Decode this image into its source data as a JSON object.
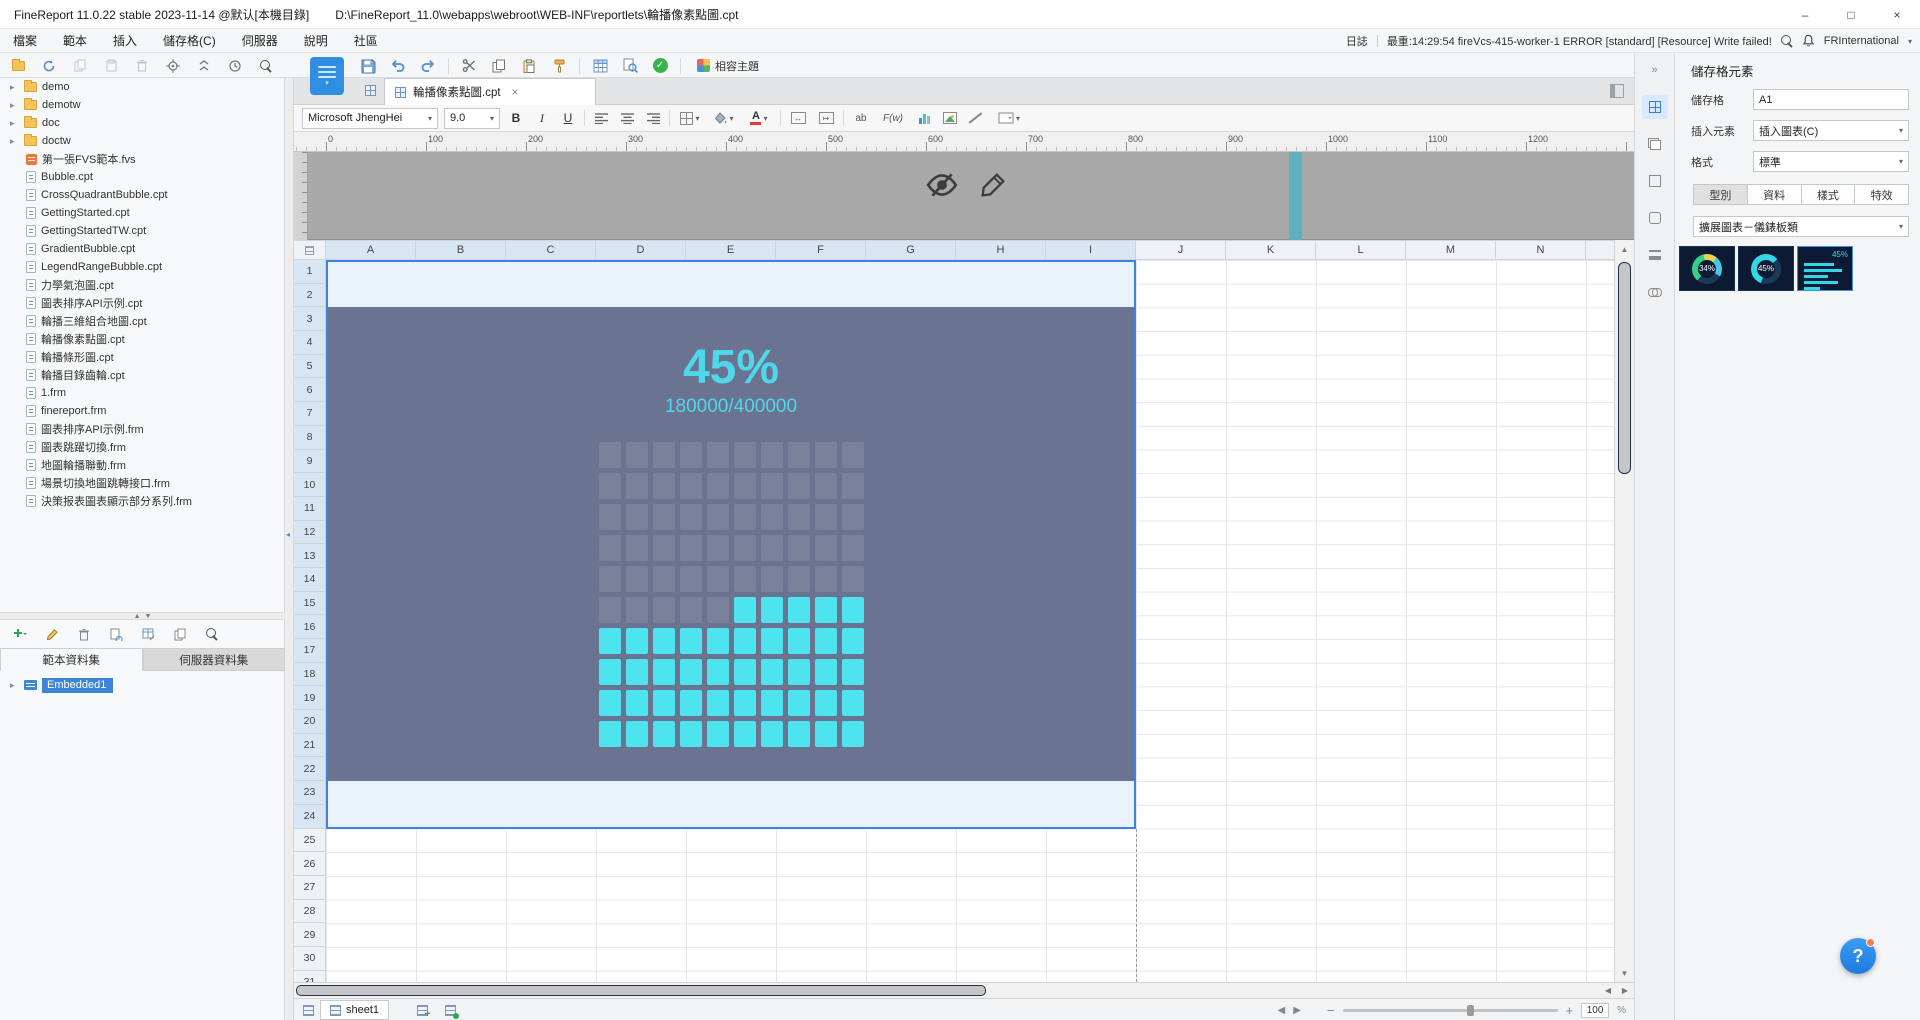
{
  "window": {
    "title": "FineReport 11.0.22 stable 2023-11-14 @默认[本機目錄]",
    "path": "D:\\FineReport_11.0\\webapps\\webroot\\WEB-INF\\reportlets\\輪播像素點圖.cpt",
    "controls": {
      "minimize": "–",
      "maximize": "□",
      "close": "×"
    }
  },
  "menu_bar": {
    "items": [
      "檔案",
      "範本",
      "插入",
      "儲存格(C)",
      "伺服器",
      "說明",
      "社區"
    ],
    "log_label": "日誌",
    "status_text": "最重:14:29:54 fireVcs-415-worker-1 ERROR [standard] [Resource] Write failed!",
    "account": "FRInternational"
  },
  "main_toolbar": {
    "compat_theme": "相容主題"
  },
  "doc_tabs": {
    "active_tab": "輪播像素點圖.cpt"
  },
  "format_bar": {
    "font_name": "Microsoft JhengHei",
    "font_size": "9.0",
    "bold": "B",
    "italic": "I",
    "underline": "U",
    "ab": "ab",
    "fw": "F(w)"
  },
  "left_panel": {
    "folders": [
      "demo",
      "demotw",
      "doc",
      "doctw"
    ],
    "files": [
      {
        "name": "第一張FVS範本.fvs",
        "type": "fvs"
      },
      {
        "name": "Bubble.cpt",
        "type": "cpt"
      },
      {
        "name": "CrossQuadrantBubble.cpt",
        "type": "cpt"
      },
      {
        "name": "GettingStarted.cpt",
        "type": "cpt"
      },
      {
        "name": "GettingStartedTW.cpt",
        "type": "cpt"
      },
      {
        "name": "GradientBubble.cpt",
        "type": "cpt"
      },
      {
        "name": "LegendRangeBubble.cpt",
        "type": "cpt"
      },
      {
        "name": "力學氣泡圖.cpt",
        "type": "cpt"
      },
      {
        "name": "圖表排序API示例.cpt",
        "type": "cpt"
      },
      {
        "name": "輪播三維組合地圖.cpt",
        "type": "cpt"
      },
      {
        "name": "輪播像素點圖.cpt",
        "type": "cpt"
      },
      {
        "name": "輪播條形圖.cpt",
        "type": "cpt"
      },
      {
        "name": "輪播目錄齒輪.cpt",
        "type": "cpt"
      },
      {
        "name": "1.frm",
        "type": "frm"
      },
      {
        "name": "finereport.frm",
        "type": "frm"
      },
      {
        "name": "圖表排序API示例.frm",
        "type": "frm"
      },
      {
        "name": "圖表跳躍切換.frm",
        "type": "frm"
      },
      {
        "name": "地圖輪播聯動.frm",
        "type": "frm"
      },
      {
        "name": "場景切換地圖跳轉接口.frm",
        "type": "frm"
      },
      {
        "name": "決策报表圖表顯示部分系列.frm",
        "type": "frm"
      }
    ],
    "dataset_tabs": [
      "範本資料集",
      "伺服器資料集"
    ],
    "datasets": [
      "Embedded1"
    ]
  },
  "spreadsheet": {
    "columns": [
      "A",
      "B",
      "C",
      "D",
      "E",
      "F",
      "G",
      "H",
      "I",
      "J",
      "K",
      "L",
      "M",
      "N"
    ],
    "selected_columns": [
      "A",
      "B",
      "C",
      "D",
      "E",
      "F",
      "G",
      "H",
      "I"
    ],
    "row_count": 31,
    "selected_rows_to": 24,
    "ruler_max": 1200
  },
  "chart_data": {
    "type": "pixel-grid-gauge",
    "percent_label": "45%",
    "fraction_label": "180000/400000",
    "value": 180000,
    "total": 400000,
    "grid_rows": 10,
    "grid_cols": 10,
    "filled_cells": 45,
    "fill_direction": "bottom-up, partial row right-aligned",
    "colors": {
      "background": "#6a7390",
      "filled": "#4ee4ef",
      "empty_cell": "rgba(255,255,255,0.10)",
      "text": "#4dd9e9"
    }
  },
  "right_panel": {
    "title": "儲存格元素",
    "cell_label": "儲存格",
    "cell_ref": "A1",
    "insert_label": "插入元素",
    "insert_value": "插入圖表(C)",
    "format_label": "格式",
    "format_value": "標準",
    "tabs": [
      "型別",
      "資料",
      "樣式",
      "特效"
    ],
    "chart_category": "擴展圖表－儀錶板類",
    "thumbnails": [
      {
        "label": "34%",
        "kind": "ring-multicolor",
        "selected": false
      },
      {
        "label": "45%",
        "kind": "ring-cyan",
        "selected": false
      },
      {
        "label": "45%",
        "kind": "pixel-bars",
        "selected": true
      }
    ]
  },
  "bottom_bar": {
    "sheet_name": "sheet1",
    "zoom_value": "100",
    "zoom_unit": "%"
  },
  "colors": {
    "accent": "#2f7fdb",
    "selection_border": "#3f82d8"
  }
}
